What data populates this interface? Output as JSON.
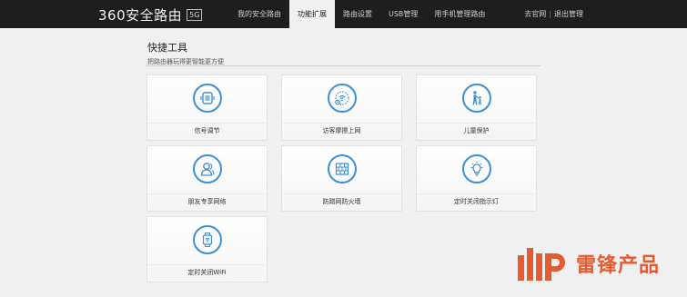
{
  "header": {
    "brand": "360安全路由",
    "badge": "5G",
    "nav": [
      "我的安全路由",
      "功能扩展",
      "路由设置",
      "USB管理",
      "用手机管理路由"
    ],
    "active_index": 1,
    "links": [
      "去官网",
      "退出管理"
    ]
  },
  "section": {
    "title": "快捷工具",
    "subtitle": "把路由器玩得更智能更方便"
  },
  "tools": [
    {
      "label": "信号调节",
      "icon": "signal-adjust-icon"
    },
    {
      "label": "访客摩擦上网",
      "icon": "guest-wifi-icon"
    },
    {
      "label": "儿童保护",
      "icon": "child-protection-icon"
    },
    {
      "label": "朋友专享网络",
      "icon": "friend-network-icon"
    },
    {
      "label": "防蹭网防火墙",
      "icon": "firewall-icon"
    },
    {
      "label": "定时关闭指示灯",
      "icon": "light-bulb-icon"
    },
    {
      "label": "定时关闭WiFi",
      "icon": "wifi-timer-icon"
    }
  ],
  "watermark": {
    "text": "雷锋产品"
  },
  "colors": {
    "accent": "#3d8fd6",
    "topbar": "#1e1e1e",
    "watermark": "#e65a30"
  }
}
